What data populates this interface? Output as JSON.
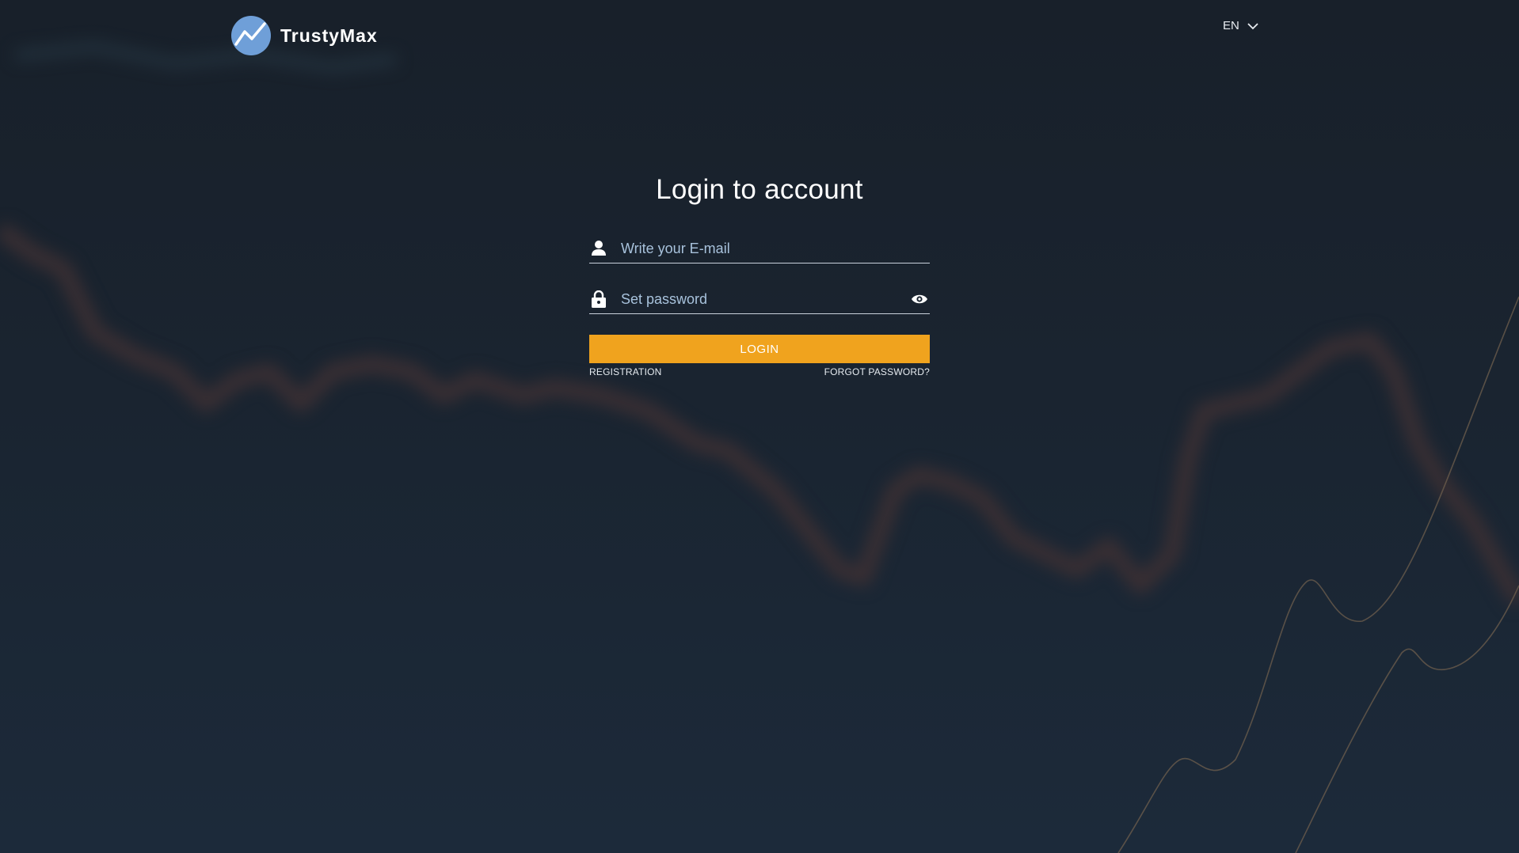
{
  "brand": {
    "name": "TrustyMax",
    "logo_icon": "trend-line-icon"
  },
  "language": {
    "current": "EN",
    "icon": "chevron-down-icon"
  },
  "login": {
    "title": "Login to account",
    "email_placeholder": "Write your E-mail",
    "password_placeholder": "Set password",
    "login_button": "LOGIN",
    "registration_link": "REGISTRATION",
    "forgot_link": "FORGOT PASSWORD?"
  },
  "colors": {
    "accent": "#f0a31e",
    "background": "#1a2430",
    "logo_circle": "#6f9fd8",
    "text": "#ffffff"
  }
}
